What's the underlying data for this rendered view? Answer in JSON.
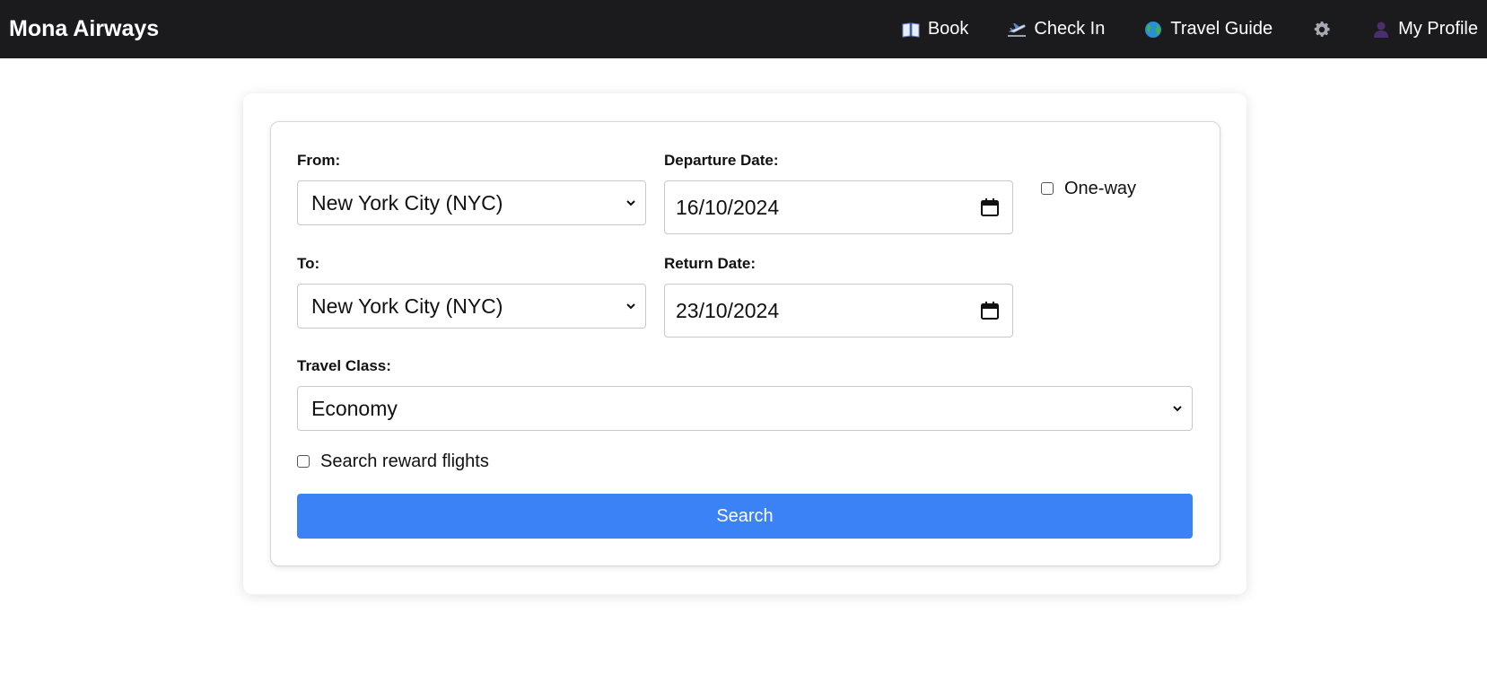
{
  "brand": "Mona Airways",
  "nav": {
    "book": {
      "icon": "book-icon",
      "label": "Book"
    },
    "checkin": {
      "icon": "airplane-departure-icon",
      "label": "Check In"
    },
    "guide": {
      "icon": "globe-icon",
      "label": "Travel Guide"
    },
    "settings": {
      "icon": "gear-icon"
    },
    "profile": {
      "icon": "person-silhouette-icon",
      "label": "My Profile"
    }
  },
  "form": {
    "from_label": "From:",
    "from_value": "New York City (NYC)",
    "to_label": "To:",
    "to_value": "New York City (NYC)",
    "departure_label": "Departure Date:",
    "departure_value": "16/10/2024",
    "return_label": "Return Date:",
    "return_value": "23/10/2024",
    "oneway_label": "One-way",
    "oneway_checked": false,
    "class_label": "Travel Class:",
    "class_value": "Economy",
    "reward_label": "Search reward flights",
    "reward_checked": false,
    "search_label": "Search"
  },
  "colors": {
    "navbar_bg": "#1b1b1d",
    "accent_button": "#3b82f6"
  }
}
